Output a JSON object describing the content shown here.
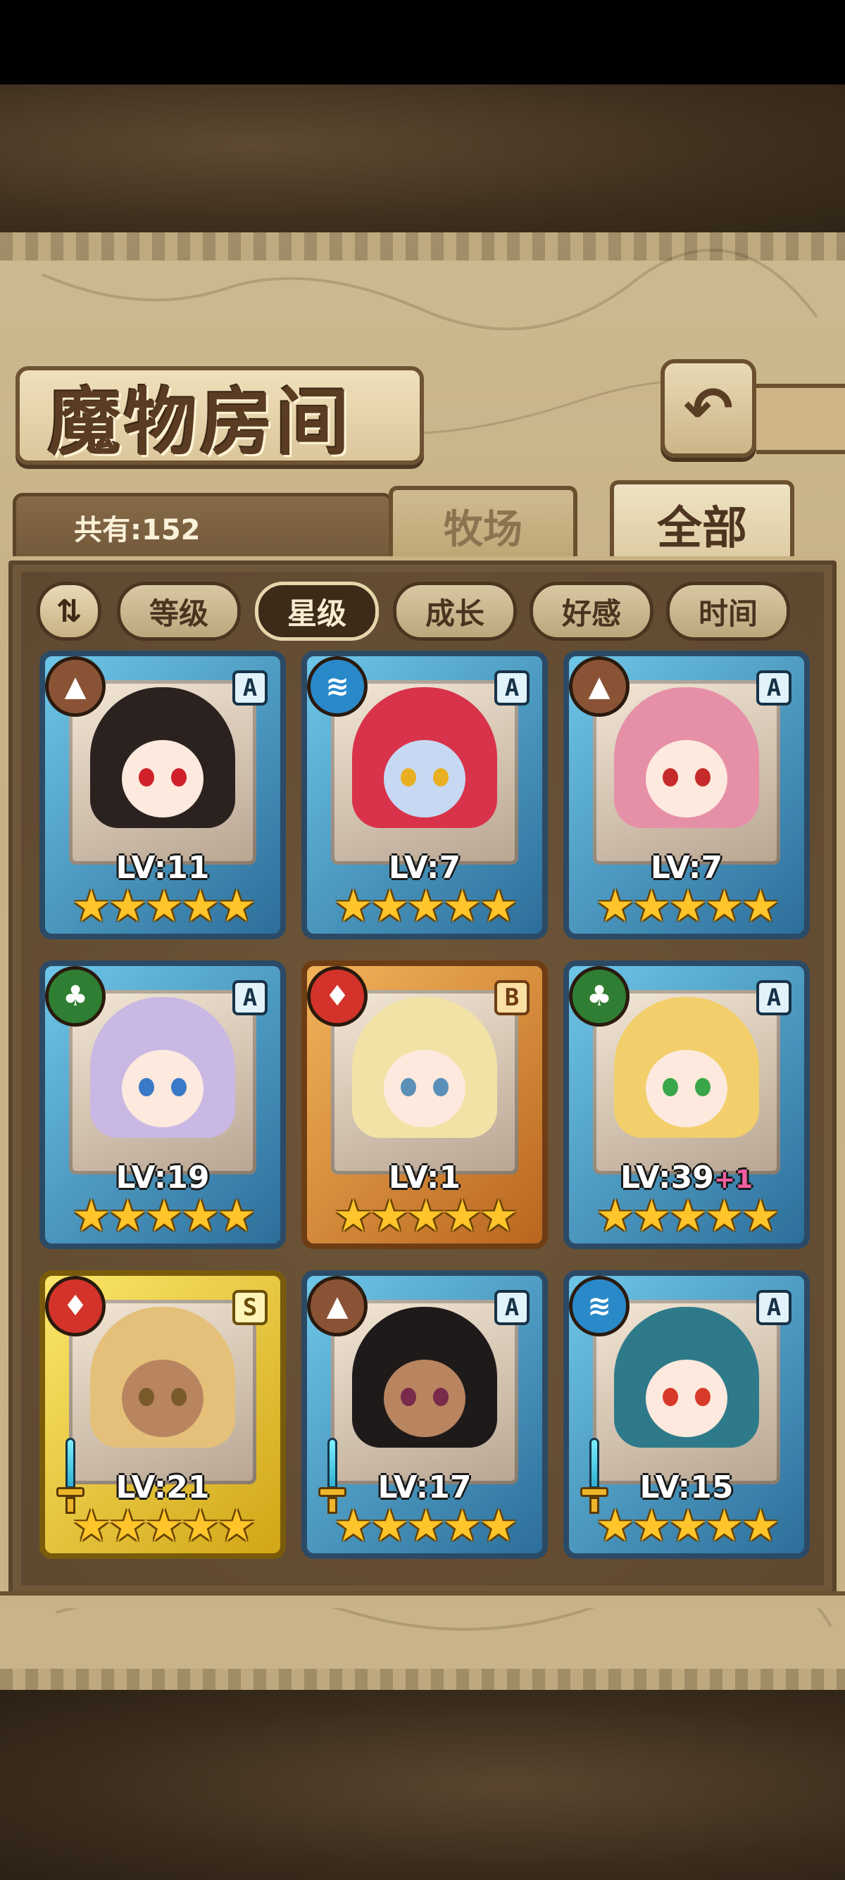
{
  "header": {
    "title": "魔物房间",
    "back_icon": "↶"
  },
  "count_label": "共有:152",
  "tabs": [
    {
      "label": "牧场",
      "active": false
    },
    {
      "label": "全部",
      "active": true
    }
  ],
  "sort_toggle_icon": "⇅",
  "filters": [
    {
      "label": "等级",
      "active": false
    },
    {
      "label": "星级",
      "active": true
    },
    {
      "label": "成长",
      "active": false
    },
    {
      "label": "好感",
      "active": false
    },
    {
      "label": "时间",
      "active": false
    }
  ],
  "monsters": [
    {
      "element": "earth",
      "element_icon": "▲",
      "rank": "A",
      "frame": "blue",
      "level": "LV:11",
      "bonus": "",
      "stars": 5,
      "has_weapon": false,
      "hair": "#2b2220",
      "eyes": "#d0202a",
      "face": "pale"
    },
    {
      "element": "water",
      "element_icon": "≋",
      "rank": "A",
      "frame": "blue",
      "level": "LV:7",
      "bonus": "",
      "stars": 5,
      "has_weapon": false,
      "hair": "#d8334a",
      "eyes": "#e8b020",
      "face": "blue"
    },
    {
      "element": "earth",
      "element_icon": "▲",
      "rank": "A",
      "frame": "blue",
      "level": "LV:7",
      "bonus": "",
      "stars": 5,
      "has_weapon": false,
      "hair": "#e690a8",
      "eyes": "#c62a2a",
      "face": "pale"
    },
    {
      "element": "nature",
      "element_icon": "♣",
      "rank": "A",
      "frame": "blue",
      "level": "LV:19",
      "bonus": "",
      "stars": 5,
      "has_weapon": false,
      "hair": "#c9b8e4",
      "eyes": "#3a78c8",
      "face": "pale"
    },
    {
      "element": "fire",
      "element_icon": "♦",
      "rank": "B",
      "frame": "orange",
      "level": "LV:1",
      "bonus": "",
      "stars": 5,
      "has_weapon": false,
      "hair": "#f3e2a6",
      "eyes": "#5a8fb8",
      "face": "pale"
    },
    {
      "element": "nature",
      "element_icon": "♣",
      "rank": "A",
      "frame": "blue",
      "level": "LV:39",
      "bonus": "+1",
      "stars": 5,
      "has_weapon": false,
      "hair": "#f2cf6a",
      "eyes": "#3aa64a",
      "face": "pale"
    },
    {
      "element": "fire",
      "element_icon": "♦",
      "rank": "S",
      "frame": "gold",
      "level": "LV:21",
      "bonus": "",
      "stars": 5,
      "has_weapon": true,
      "hair": "#e4c07a",
      "eyes": "#7a5a2a",
      "face": "dark"
    },
    {
      "element": "earth",
      "element_icon": "▲",
      "rank": "A",
      "frame": "blue",
      "level": "LV:17",
      "bonus": "",
      "stars": 5,
      "has_weapon": true,
      "hair": "#1f1a1a",
      "eyes": "#7a2a4a",
      "face": "dark"
    },
    {
      "element": "water",
      "element_icon": "≋",
      "rank": "A",
      "frame": "blue",
      "level": "LV:15",
      "bonus": "",
      "stars": 5,
      "has_weapon": true,
      "hair": "#2f7a8a",
      "eyes": "#d83a2a",
      "face": "pale"
    }
  ]
}
